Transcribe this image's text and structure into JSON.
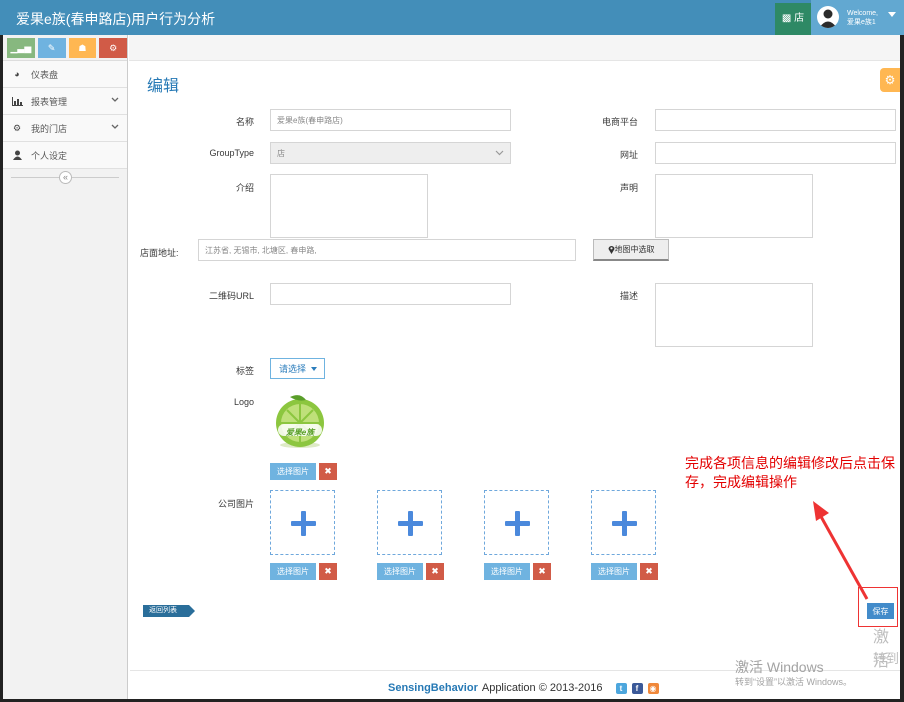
{
  "header": {
    "title": "爱果e族(春申路店)用户行为分析",
    "store_label": "店",
    "welcome_line1": "Welcome,",
    "welcome_line2": "爱果e族1"
  },
  "sidebar": {
    "shortcut_colors": [
      "#87b87f",
      "#6fb3e0",
      "#ffb752",
      "#d15b47"
    ],
    "items": [
      {
        "label": "仪表盘",
        "icon": "dashboard-icon"
      },
      {
        "label": "报表管理",
        "icon": "bar-chart-icon"
      },
      {
        "label": "我的门店",
        "icon": "gear-icon"
      },
      {
        "label": "个人设定",
        "icon": "user-icon"
      }
    ],
    "collapse_glyph": "«"
  },
  "main": {
    "title": "编辑",
    "form": {
      "name_label": "名称",
      "name_value": "爱果e族(春申路店)",
      "ecommerce_label": "电商平台",
      "ecommerce_value": "",
      "grouptype_label": "GroupType",
      "grouptype_value": "店",
      "website_label": "网址",
      "website_value": "",
      "intro_label": "介绍",
      "statement_label": "声明",
      "address_label": "店面地址:",
      "address_value": "江苏省, 无锡市, 北塘区, 春申路,",
      "map_button": "地图中选取",
      "qrcode_label": "二维码URL",
      "qrcode_value": "",
      "description_label": "描述",
      "tags_label": "标签",
      "tags_select": "请选择",
      "logo_label": "Logo",
      "logo_text": "爱果e族",
      "pick_image": "选择图片",
      "delete_glyph": "✖",
      "company_images_label": "公司图片",
      "company_image_slots": 4
    },
    "back_button": "返回列表",
    "save_button": "保存",
    "annotation": "完成各项信息的编辑修改后点击保存，完成编辑操作"
  },
  "footer": {
    "brand": "SensingBehavior",
    "text": "Application © 2013-2016",
    "social_icons": [
      "twitter-icon",
      "facebook-icon",
      "rss-icon"
    ]
  },
  "watermark": {
    "title": "激活 Windows",
    "subtitle": "转到“设置”以激活 Windows。",
    "side_title": "激活",
    "side_sub": "转到"
  }
}
